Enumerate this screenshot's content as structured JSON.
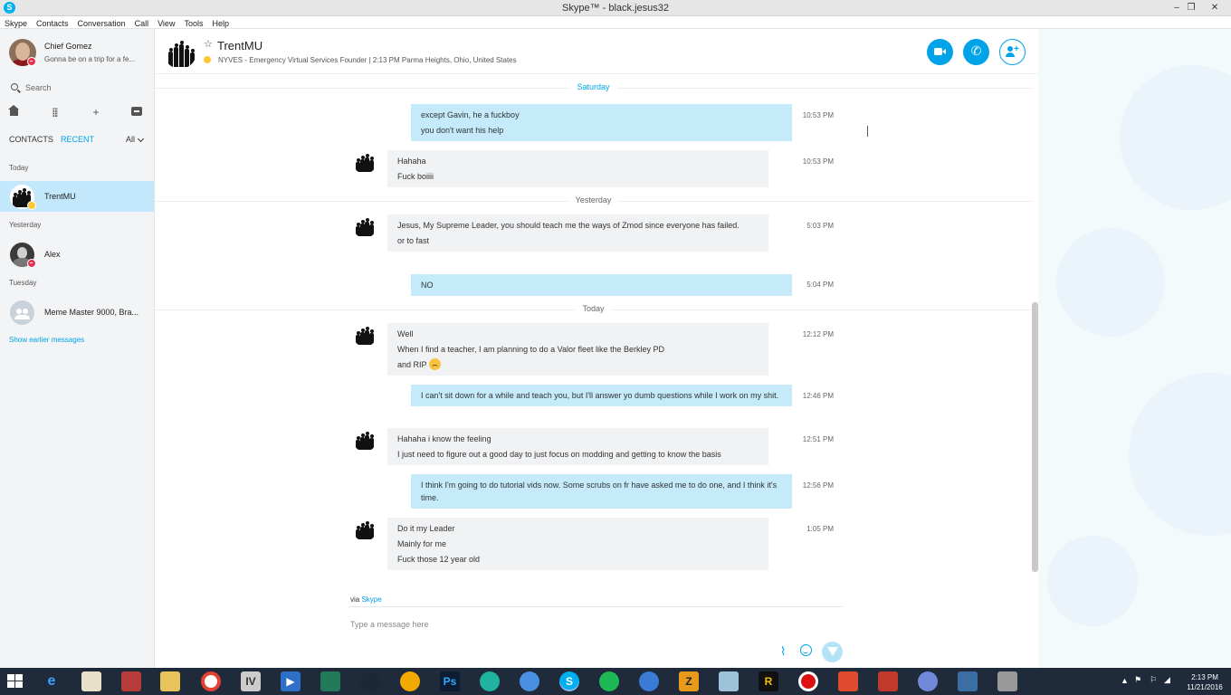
{
  "window": {
    "title": "Skype™ - black.jesus32",
    "app_icon": "S",
    "controls": {
      "minimize": "–",
      "restore": "❐",
      "close": "✕"
    }
  },
  "menubar": [
    "Skype",
    "Contacts",
    "Conversation",
    "Call",
    "View",
    "Tools",
    "Help"
  ],
  "profile": {
    "name": "Chief Gomez",
    "mood": "Gonna be on a trip for a fe..."
  },
  "search": {
    "placeholder": "Search"
  },
  "toolbar_icons": [
    "home-icon",
    "dialpad-icon",
    "plus-icon",
    "new-conversation-icon"
  ],
  "tabs": {
    "contacts": "CONTACTS",
    "recent": "RECENT",
    "filter": "All"
  },
  "recent": {
    "groups": [
      "Today",
      "Yesterday",
      "Tuesday"
    ],
    "contacts": [
      {
        "name": "TrentMU"
      },
      {
        "name": "Alex"
      },
      {
        "name": "Meme Master 9000, Bra..."
      }
    ],
    "show_earlier": "Show earlier messages"
  },
  "conversation": {
    "name": "TrentMU",
    "mood": "NYVES - Emergency Virtual Services Founder  |  2:13 PM Parma Heights, Ohio, United States",
    "separators": {
      "saturday": "Saturday",
      "yesterday": "Yesterday",
      "today": "Today"
    },
    "messages": [
      {
        "dir": "out",
        "time": "10:53 PM",
        "lines": [
          "except Gavin, he a fuckboy",
          "you don't want his help"
        ]
      },
      {
        "dir": "in",
        "time": "10:53 PM",
        "lines": [
          "Hahaha",
          "Fuck boiiii"
        ]
      },
      {
        "dir": "in",
        "time": "5:03 PM",
        "lines": [
          "Jesus, My Supreme Leader, you should teach me the ways of Zmod since everyone has failed.",
          "or to fast"
        ]
      },
      {
        "dir": "out",
        "time": "5:04 PM",
        "lines": [
          "NO"
        ]
      },
      {
        "dir": "in",
        "time": "12:12 PM",
        "lines": [
          "Well",
          "When I find a teacher, I am planning to do a Valor fleet like the Berkley PD",
          "and RIP"
        ]
      },
      {
        "dir": "out",
        "time": "12:46 PM",
        "lines": [
          "I can't sit down for a while and teach you, but I'll answer yo dumb questions while I work on my shit."
        ]
      },
      {
        "dir": "in",
        "time": "12:51 PM",
        "lines": [
          "Hahaha i know the feeling",
          "I just need to figure out a good day to just focus on modding and getting to know the basis"
        ]
      },
      {
        "dir": "out",
        "time": "12:56 PM",
        "lines": [
          "I think I'm going to do tutorial vids now. Some scrubs on fr have asked me to do one, and I think it's time."
        ]
      },
      {
        "dir": "in",
        "time": "1:05 PM",
        "lines": [
          "Do it my Leader",
          "Mainly for me",
          "Fuck those 12 year old"
        ]
      }
    ]
  },
  "composer": {
    "via_prefix": "via",
    "via_link": "Skype",
    "placeholder": "Type a message here"
  },
  "taskbar": {
    "time": "2:13 PM",
    "date": "11/21/2016"
  },
  "colors": {
    "accent": "#00a2e8",
    "outgoing_bubble": "#c5ebfb",
    "incoming_bubble": "#f1f2f4",
    "selected_contact": "#c3e7fb",
    "status_dnd": "#e7334f",
    "status_away": "#ffc733",
    "taskbar": "#1f2a3a"
  }
}
